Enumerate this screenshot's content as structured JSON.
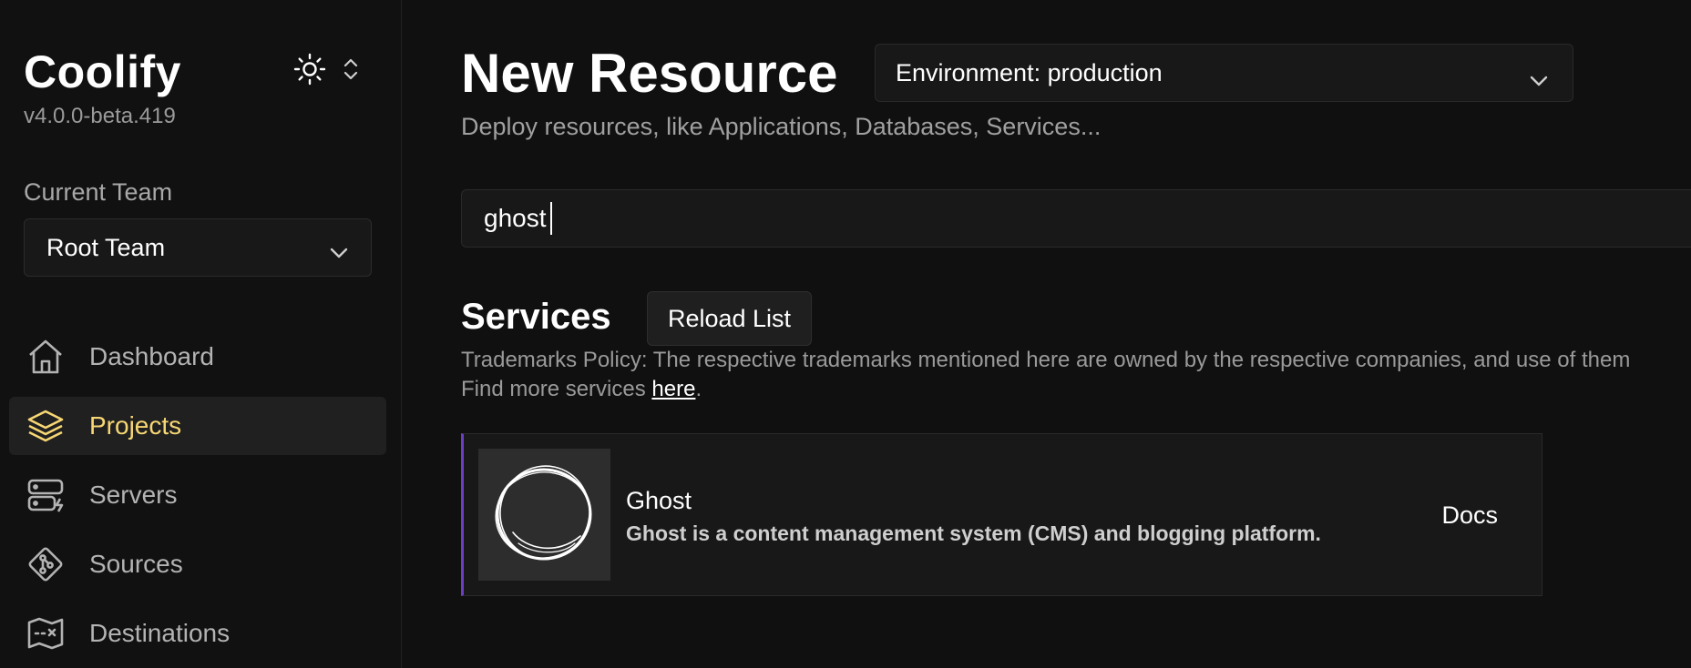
{
  "brand": {
    "name": "Coolify",
    "version": "v4.0.0-beta.419"
  },
  "team": {
    "label": "Current Team",
    "selected": "Root Team"
  },
  "nav": {
    "items": [
      {
        "label": "Dashboard",
        "icon": "home-icon",
        "active": false
      },
      {
        "label": "Projects",
        "icon": "layers-icon",
        "active": true
      },
      {
        "label": "Servers",
        "icon": "server-icon",
        "active": false
      },
      {
        "label": "Sources",
        "icon": "git-icon",
        "active": false
      },
      {
        "label": "Destinations",
        "icon": "map-icon",
        "active": false
      }
    ]
  },
  "page": {
    "title": "New Resource",
    "subtitle": "Deploy resources, like Applications, Databases, Services...",
    "environment": "Environment: production"
  },
  "search": {
    "value": "ghost"
  },
  "services": {
    "heading": "Services",
    "reload_label": "Reload List",
    "policy": "Trademarks Policy: The respective trademarks mentioned here are owned by the respective companies, and use of them",
    "find_more_prefix": "Find more services ",
    "find_more_link": "here",
    "find_more_suffix": ".",
    "items": [
      {
        "name": "Ghost",
        "description": "Ghost is a content management system (CMS) and blogging platform.",
        "docs_label": "Docs"
      }
    ]
  },
  "colors": {
    "accent": "#f7d774",
    "card_border": "#6b3fc4",
    "background": "#101010"
  }
}
